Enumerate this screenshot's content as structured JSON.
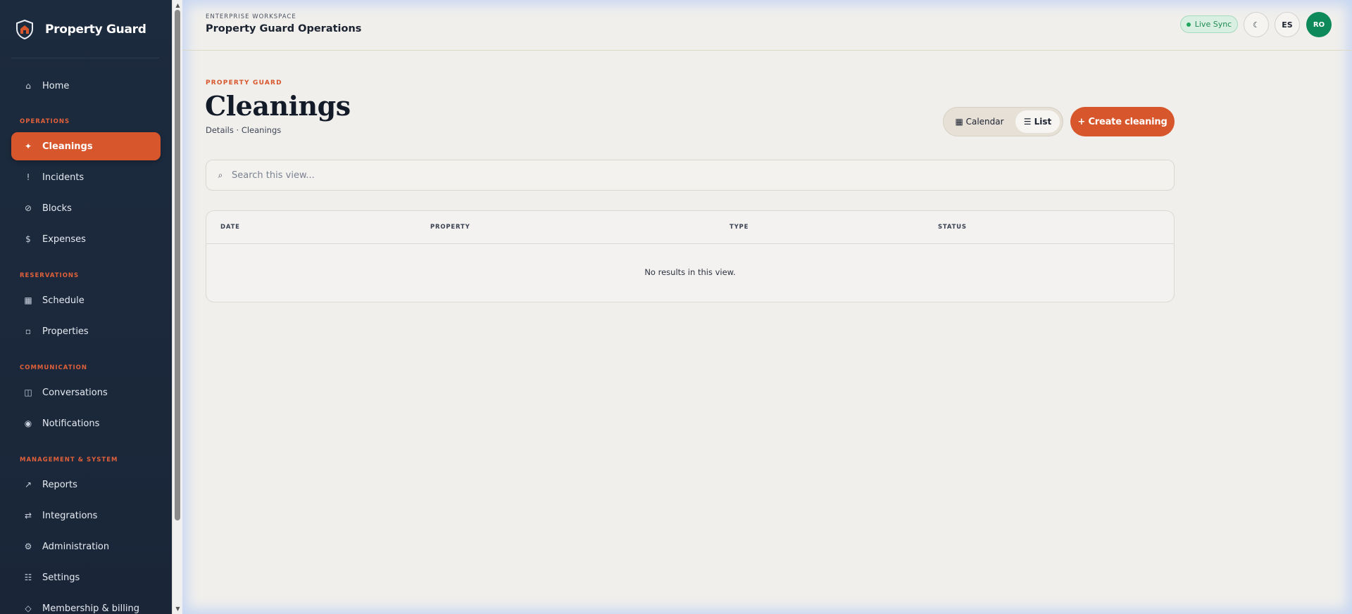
{
  "sidebar": {
    "brand": "Property Guard",
    "items": [
      {
        "label": "Home",
        "icon": "home-icon",
        "glyph": "⌂"
      },
      {
        "label": "Cleanings",
        "icon": "sparkle-icon",
        "glyph": "✦"
      },
      {
        "label": "Incidents",
        "icon": "alert-icon",
        "glyph": "!"
      },
      {
        "label": "Blocks",
        "icon": "block-icon",
        "glyph": "⊘"
      },
      {
        "label": "Expenses",
        "icon": "dollar-icon",
        "glyph": "$"
      },
      {
        "label": "Schedule",
        "icon": "calendar-icon",
        "glyph": "▦"
      },
      {
        "label": "Properties",
        "icon": "property-icon",
        "glyph": "▫"
      },
      {
        "label": "Conversations",
        "icon": "conversation-icon",
        "glyph": "◫"
      },
      {
        "label": "Notifications",
        "icon": "notification-icon",
        "glyph": "◉"
      },
      {
        "label": "Reports",
        "icon": "reports-icon",
        "glyph": "↗"
      },
      {
        "label": "Integrations",
        "icon": "integrations-icon",
        "glyph": "⇄"
      },
      {
        "label": "Administration",
        "icon": "admin-icon",
        "glyph": "⚙"
      },
      {
        "label": "Settings",
        "icon": "settings-icon",
        "glyph": "☷"
      },
      {
        "label": "Membership & billing",
        "icon": "billing-icon",
        "glyph": "◇"
      }
    ],
    "sections": {
      "operations": "OPERATIONS",
      "reservations": "RESERVATIONS",
      "communication": "COMMUNICATION",
      "management": "MANAGEMENT & SYSTEM"
    }
  },
  "topbar": {
    "workspace_label": "ENTERPRISE WORKSPACE",
    "workspace_title": "Property Guard Operations",
    "live_sync": "Live Sync",
    "theme_glyph": "☾",
    "language": "ES",
    "avatar_initials": "RO"
  },
  "page": {
    "eyebrow": "PROPERTY GUARD",
    "title": "Cleanings",
    "breadcrumb": "Details · Cleanings",
    "view_calendar": "▦ Calendar",
    "view_list": "☰ List",
    "create_button": "+ Create cleaning",
    "search_placeholder": "Search this view...",
    "search_glyph": "⌕"
  },
  "table": {
    "columns": [
      "DATE",
      "PROPERTY",
      "TYPE",
      "STATUS"
    ],
    "empty_message": "No results in this view."
  },
  "colors": {
    "accent": "#d8562c",
    "sidebar_bg": "#1d2b3f",
    "live_green": "#22a55c",
    "avatar_bg": "#0e8a5a"
  }
}
